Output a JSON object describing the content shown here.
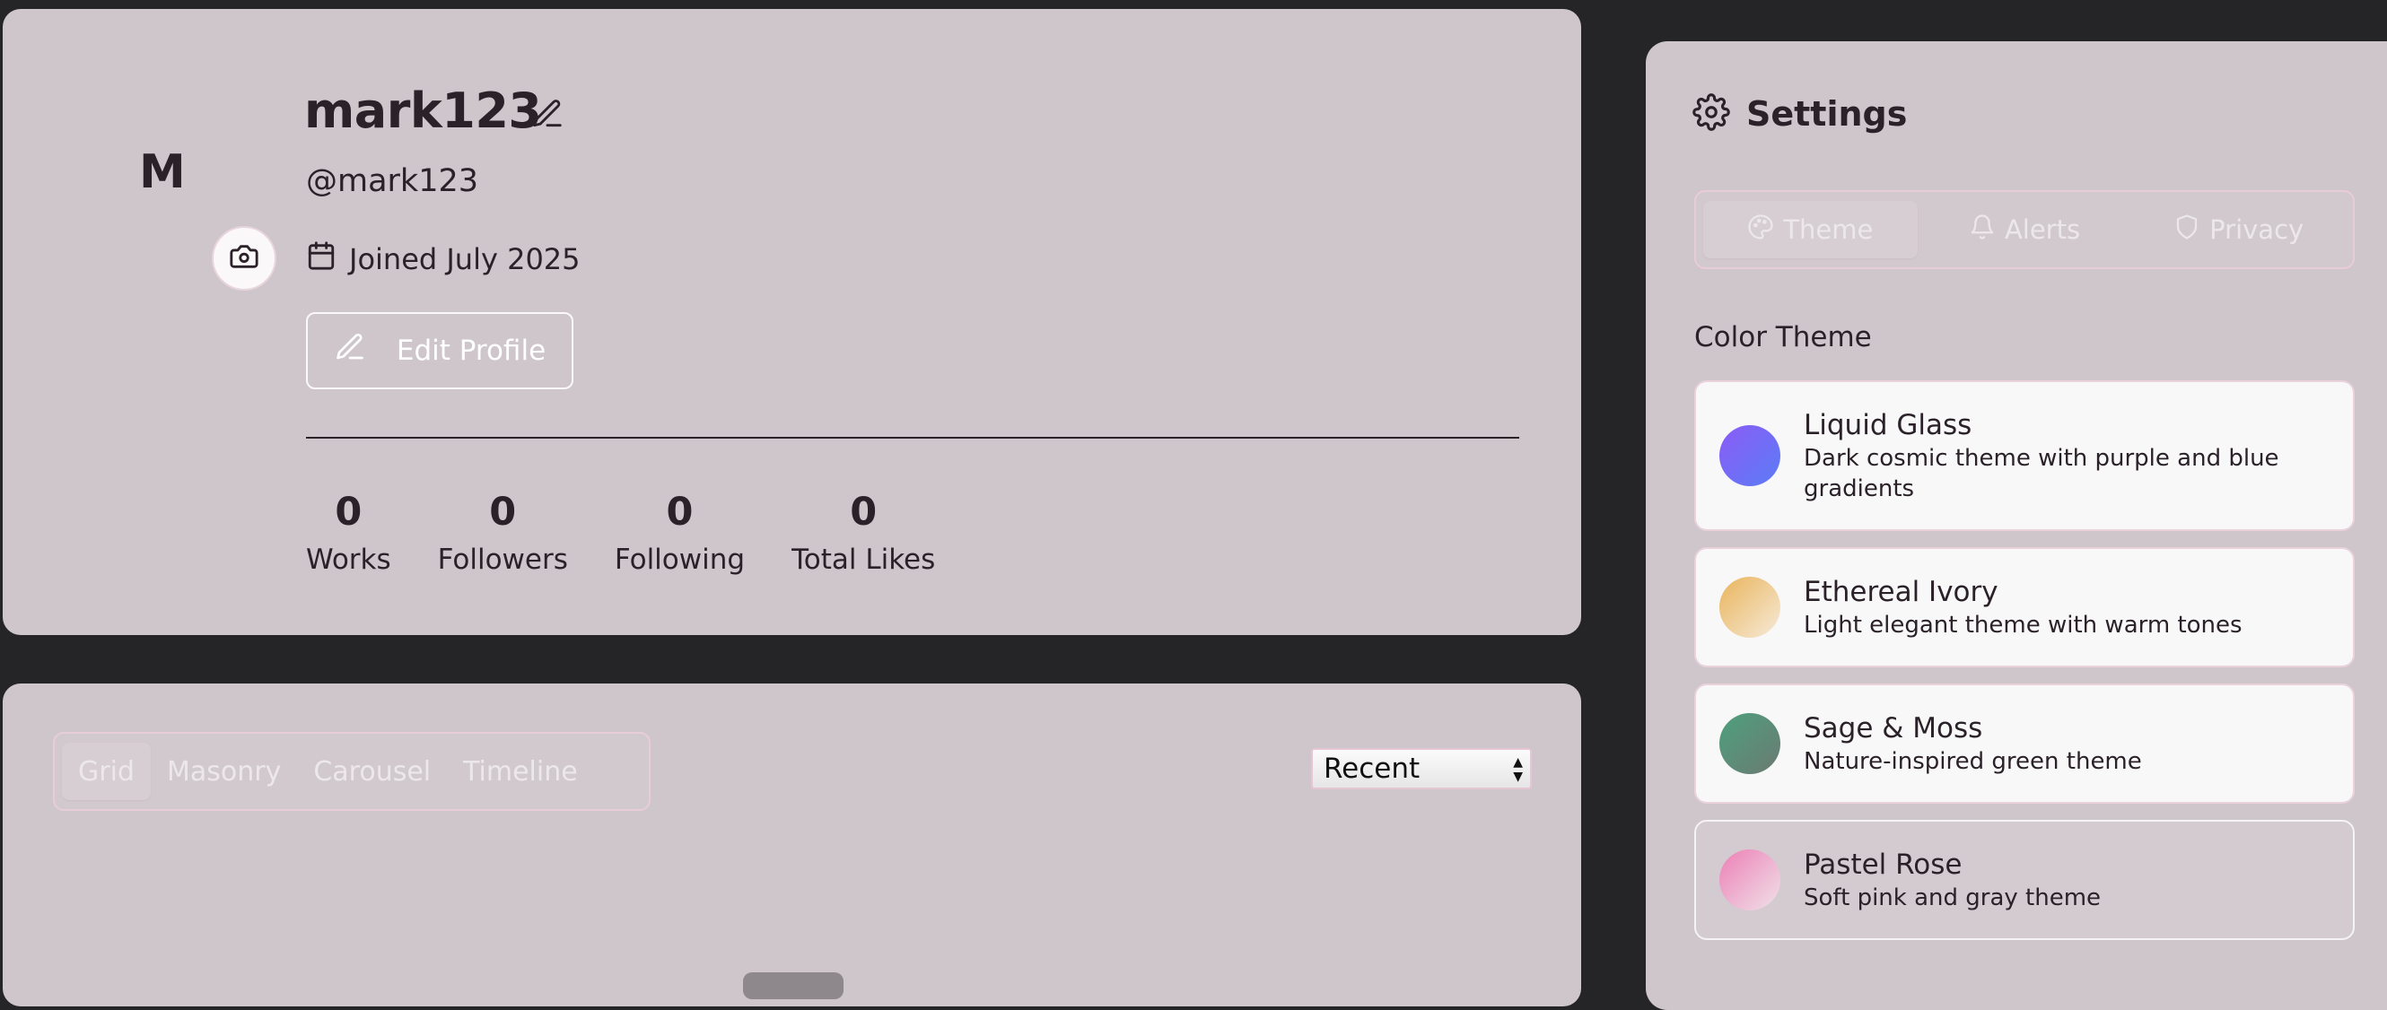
{
  "profile": {
    "avatar_initial": "M",
    "display_name": "mark123",
    "handle": "@mark123",
    "joined": "Joined July 2025",
    "edit_profile_label": "Edit Profile",
    "stats": [
      {
        "value": "0",
        "label": "Works"
      },
      {
        "value": "0",
        "label": "Followers"
      },
      {
        "value": "0",
        "label": "Following"
      },
      {
        "value": "0",
        "label": "Total Likes"
      }
    ]
  },
  "gallery": {
    "view_tabs": [
      "Grid",
      "Masonry",
      "Carousel",
      "Timeline"
    ],
    "active_view": "Grid",
    "sort_value": "Recent"
  },
  "settings": {
    "title": "Settings",
    "tabs": [
      "Theme",
      "Alerts",
      "Privacy"
    ],
    "active_tab": "Theme",
    "section_title": "Color Theme",
    "themes": [
      {
        "name": "Liquid Glass",
        "description": "Dark cosmic theme with purple and blue gradients",
        "swatch_from": "#8b5cf6",
        "swatch_to": "#5b7cf6"
      },
      {
        "name": "Ethereal Ivory",
        "description": "Light elegant theme with warm tones",
        "swatch_from": "#e9b45c",
        "swatch_to": "#f6ead8"
      },
      {
        "name": "Sage & Moss",
        "description": "Nature-inspired green theme",
        "swatch_from": "#4ea07e",
        "swatch_to": "#6b7a72"
      },
      {
        "name": "Pastel Rose",
        "description": "Soft pink and gray theme",
        "swatch_from": "#ec7fb6",
        "swatch_to": "#f0e2e8"
      }
    ],
    "selected_theme": "Pastel Rose"
  }
}
